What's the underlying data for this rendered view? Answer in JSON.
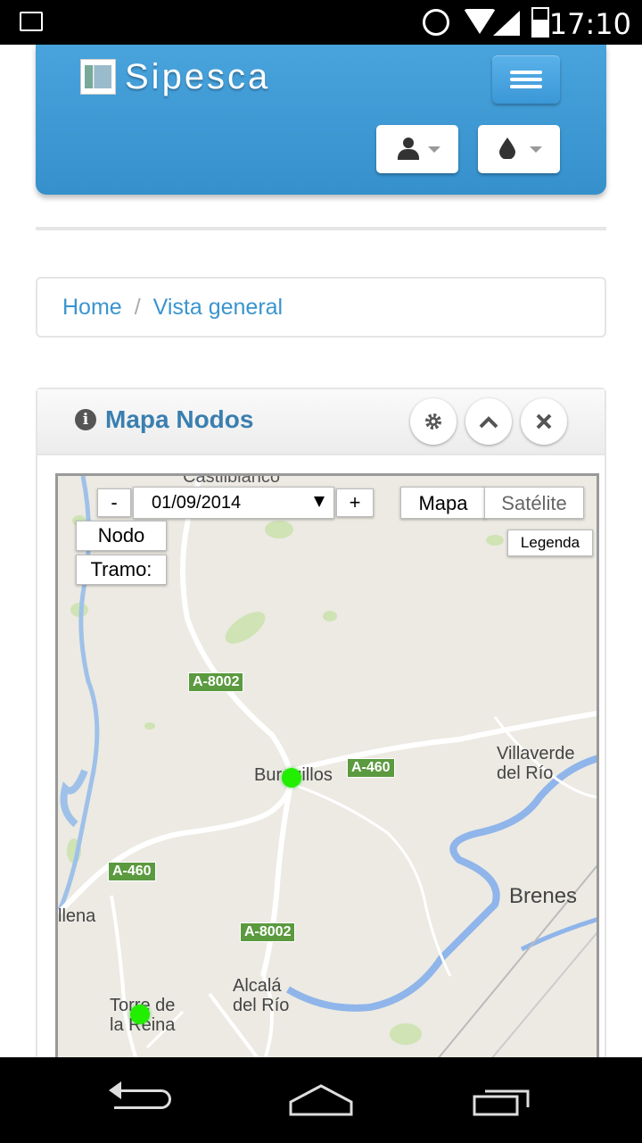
{
  "status_bar": {
    "time": "17:10",
    "battery": "22"
  },
  "header": {
    "brand": "Sipesca"
  },
  "breadcrumb": {
    "home": "Home",
    "separator": "/",
    "current": "Vista general"
  },
  "panel": {
    "title": "Mapa Nodos"
  },
  "map": {
    "date_minus": "-",
    "date_value": "01/09/2014",
    "date_plus": "+",
    "map_type_map": "Mapa",
    "map_type_satellite": "Satélite",
    "node_button": "Nodo",
    "tramo_button": "Tramo:",
    "legend_button": "Legenda",
    "labels": {
      "top_partial": "Castilblanco",
      "burguillos": "Burguillos",
      "villaverde": "Villaverde\ndel Río",
      "brenes": "Brenes",
      "alcala": "Alcalá\ndel Río",
      "torre": "Torre de\nla Reina",
      "left_partial": "llena"
    },
    "roads": {
      "r1": "A-8002",
      "r2": "A-460",
      "r3": "A-460",
      "r4": "A-8002"
    }
  },
  "colors": {
    "accent": "#3a94cf",
    "node": "#22ee00",
    "road_badge": "#5b9a3f"
  }
}
